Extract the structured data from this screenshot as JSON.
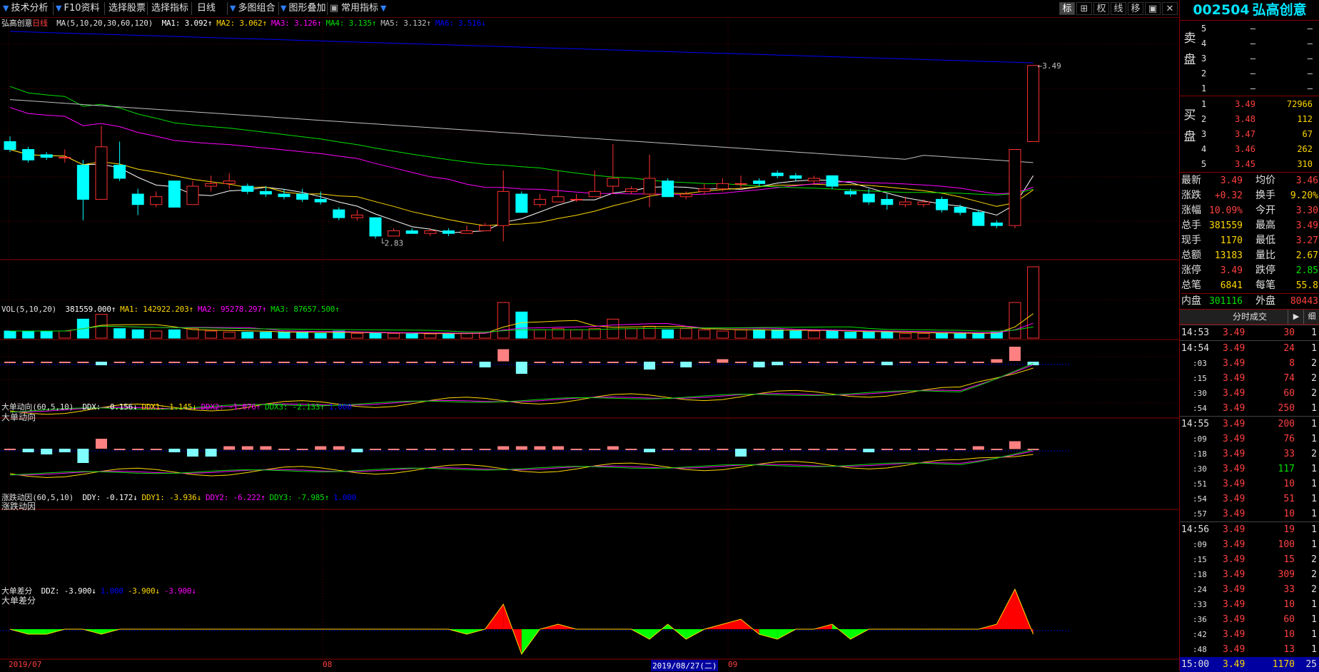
{
  "toolbar": {
    "items": [
      "技术分析",
      "F10资料",
      "选择股票",
      "选择指标",
      "日线",
      "多图组合",
      "图形叠加",
      "常用指标"
    ],
    "right_icons": [
      "标",
      "⊞",
      "权",
      "线",
      "移",
      "▣",
      "✕"
    ]
  },
  "main_chart": {
    "stock_label": "弘高创意",
    "period_label": "日线",
    "indicator_label": "MA(5,10,20,30,60,120)",
    "ma_values": [
      {
        "text": "MA1: 3.092↑",
        "color": "#ffffff"
      },
      {
        "text": "MA2: 3.062↑",
        "color": "#ffd700"
      },
      {
        "text": "MA3: 3.126↑",
        "color": "#ff00ff"
      },
      {
        "text": "MA4: 3.135↑",
        "color": "#00e000"
      },
      {
        "text": "MA5: 3.132↑",
        "color": "#c0c0c0"
      },
      {
        "text": "MA6: 3.516↓",
        "color": "#0000ff"
      }
    ],
    "high_label": "3.49",
    "low_label": "2.83"
  },
  "volume_panel": {
    "title": "VOL(5,10,20)",
    "values": [
      {
        "text": "381559.000↑",
        "color": "#ffffff"
      },
      {
        "text": "MA1: 142922.203↑",
        "color": "#ffd700"
      },
      {
        "text": "MA2: 95278.297↑",
        "color": "#ff00ff"
      },
      {
        "text": "MA3: 87657.500↑",
        "color": "#00e000"
      }
    ]
  },
  "ddx_panel": {
    "header": "大单动向(60,5,10)",
    "title": "大单动向",
    "values": [
      {
        "text": "DDX: -0.156↓",
        "color": "#ffffff"
      },
      {
        "text": "DDX1: 1.145↓",
        "color": "#ffd700"
      },
      {
        "text": "DDX2: -1.076↑",
        "color": "#ff00ff"
      },
      {
        "text": "DDX3: -2.133↑",
        "color": "#00e000"
      },
      {
        "text": "1.000",
        "color": "#0000ff"
      }
    ]
  },
  "ddy_panel": {
    "header": "涨跌动因(60,5,10)",
    "title": "涨跌动因",
    "values": [
      {
        "text": "DDY: -0.172↓",
        "color": "#ffffff"
      },
      {
        "text": "DDY1: -3.936↓",
        "color": "#ffd700"
      },
      {
        "text": "DDY2: -6.222↑",
        "color": "#ff00ff"
      },
      {
        "text": "DDY3: -7.985↑",
        "color": "#00e000"
      },
      {
        "text": "1.000",
        "color": "#0000ff"
      }
    ]
  },
  "ddz_panel": {
    "header": "大单差分",
    "title": "大单差分",
    "values": [
      {
        "text": "DDZ: -3.900↓",
        "color": "#ffffff"
      },
      {
        "text": "1.000",
        "color": "#0000ff"
      },
      {
        "text": "-3.900↓",
        "color": "#ffd700"
      },
      {
        "text": "-3.900↓",
        "color": "#ff00ff"
      }
    ]
  },
  "date_axis": {
    "labels": [
      "2019/07",
      "08",
      "2019/08/27(二)",
      "09"
    ]
  },
  "quote_panel": {
    "code": "002504",
    "name": "弘高创意",
    "sell_label": "卖盘",
    "buy_label": "买盘",
    "sell_book": [
      {
        "level": "5",
        "price": "–",
        "vol": "–"
      },
      {
        "level": "4",
        "price": "–",
        "vol": "–"
      },
      {
        "level": "3",
        "price": "–",
        "vol": "–"
      },
      {
        "level": "2",
        "price": "–",
        "vol": "–"
      },
      {
        "level": "1",
        "price": "–",
        "vol": "–"
      }
    ],
    "buy_book": [
      {
        "level": "1",
        "price": "3.49",
        "vol": "72966"
      },
      {
        "level": "2",
        "price": "3.48",
        "vol": "112"
      },
      {
        "level": "3",
        "price": "3.47",
        "vol": "67"
      },
      {
        "level": "4",
        "price": "3.46",
        "vol": "262"
      },
      {
        "level": "5",
        "price": "3.45",
        "vol": "310"
      }
    ],
    "stats": [
      {
        "k1": "最新",
        "v1": "3.49",
        "c1": "red",
        "k2": "均价",
        "v2": "3.46",
        "c2": "red"
      },
      {
        "k1": "涨跌",
        "v1": "+0.32",
        "c1": "red",
        "k2": "换手",
        "v2": "9.20%",
        "c2": "yellow"
      },
      {
        "k1": "涨幅",
        "v1": "10.09%",
        "c1": "red",
        "k2": "今开",
        "v2": "3.30",
        "c2": "red"
      },
      {
        "k1": "总手",
        "v1": "381559",
        "c1": "yellow",
        "k2": "最高",
        "v2": "3.49",
        "c2": "red"
      },
      {
        "k1": "现手",
        "v1": "1170",
        "c1": "yellow",
        "k2": "最低",
        "v2": "3.27",
        "c2": "red"
      },
      {
        "k1": "总额",
        "v1": "13183",
        "c1": "yellow",
        "k2": "量比",
        "v2": "2.67",
        "c2": "yellow"
      },
      {
        "k1": "涨停",
        "v1": "3.49",
        "c1": "red",
        "k2": "跌停",
        "v2": "2.85",
        "c2": "green"
      },
      {
        "k1": "总笔",
        "v1": "6841",
        "c1": "yellow",
        "k2": "每笔",
        "v2": "55.8",
        "c2": "yellow"
      },
      {
        "k1": "内盘",
        "v1": "301116",
        "c1": "green",
        "k2": "外盘",
        "v2": "80443",
        "c2": "red"
      }
    ],
    "trades_title": "分时成交",
    "trades_btn1": "▶",
    "trades_btn2": "细",
    "trades": [
      {
        "t": "14:53",
        "p": "3.49",
        "v": "30",
        "vc": "red",
        "n": "1",
        "m": true
      },
      {
        "t": "14:54",
        "p": "3.49",
        "v": "24",
        "vc": "red",
        "n": "1",
        "m": true
      },
      {
        "t": ":03",
        "p": "3.49",
        "v": "8",
        "vc": "red",
        "n": "2",
        "m": false
      },
      {
        "t": ":15",
        "p": "3.49",
        "v": "74",
        "vc": "red",
        "n": "2",
        "m": false
      },
      {
        "t": ":30",
        "p": "3.49",
        "v": "60",
        "vc": "red",
        "n": "2",
        "m": false
      },
      {
        "t": ":54",
        "p": "3.49",
        "v": "250",
        "vc": "red",
        "n": "1",
        "m": false
      },
      {
        "t": "14:55",
        "p": "3.49",
        "v": "200",
        "vc": "red",
        "n": "1",
        "m": true
      },
      {
        "t": ":09",
        "p": "3.49",
        "v": "76",
        "vc": "red",
        "n": "1",
        "m": false
      },
      {
        "t": ":18",
        "p": "3.49",
        "v": "33",
        "vc": "red",
        "n": "2",
        "m": false
      },
      {
        "t": ":30",
        "p": "3.49",
        "v": "117",
        "vc": "green",
        "n": "1",
        "m": false
      },
      {
        "t": ":51",
        "p": "3.49",
        "v": "10",
        "vc": "red",
        "n": "1",
        "m": false
      },
      {
        "t": ":54",
        "p": "3.49",
        "v": "51",
        "vc": "red",
        "n": "1",
        "m": false
      },
      {
        "t": ":57",
        "p": "3.49",
        "v": "10",
        "vc": "red",
        "n": "1",
        "m": false
      },
      {
        "t": "14:56",
        "p": "3.49",
        "v": "19",
        "vc": "red",
        "n": "1",
        "m": true
      },
      {
        "t": ":09",
        "p": "3.49",
        "v": "100",
        "vc": "red",
        "n": "1",
        "m": false
      },
      {
        "t": ":15",
        "p": "3.49",
        "v": "15",
        "vc": "red",
        "n": "2",
        "m": false
      },
      {
        "t": ":18",
        "p": "3.49",
        "v": "309",
        "vc": "red",
        "n": "2",
        "m": false
      },
      {
        "t": ":24",
        "p": "3.49",
        "v": "33",
        "vc": "red",
        "n": "2",
        "m": false
      },
      {
        "t": ":33",
        "p": "3.49",
        "v": "10",
        "vc": "red",
        "n": "1",
        "m": false
      },
      {
        "t": ":36",
        "p": "3.49",
        "v": "60",
        "vc": "red",
        "n": "1",
        "m": false
      },
      {
        "t": ":42",
        "p": "3.49",
        "v": "10",
        "vc": "red",
        "n": "1",
        "m": false
      },
      {
        "t": ":48",
        "p": "3.49",
        "v": "13",
        "vc": "red",
        "n": "1",
        "m": false
      },
      {
        "t": "15:00",
        "p": "3.49",
        "v": "1170",
        "vc": "yellow",
        "n": "25",
        "m": true,
        "final": true
      }
    ]
  },
  "chart_data": {
    "type": "candlestick",
    "price_range": [
      2.75,
      3.62
    ],
    "candles": [
      [
        3.2,
        3.17,
        3.22,
        3.16
      ],
      [
        3.17,
        3.13,
        3.18,
        3.12
      ],
      [
        3.15,
        3.14,
        3.16,
        3.13
      ],
      [
        3.14,
        3.14,
        3.17,
        3.12
      ],
      [
        3.11,
        2.98,
        3.13,
        2.9
      ],
      [
        2.98,
        3.18,
        3.26,
        2.98
      ],
      [
        3.11,
        3.06,
        3.2,
        3.05
      ],
      [
        3.0,
        2.96,
        3.02,
        2.92
      ],
      [
        2.96,
        2.99,
        3.01,
        2.95
      ],
      [
        3.05,
        2.95,
        3.05,
        2.95
      ],
      [
        2.96,
        3.03,
        3.05,
        2.96
      ],
      [
        3.03,
        3.04,
        3.07,
        3.01
      ],
      [
        3.04,
        3.05,
        3.08,
        3.02
      ],
      [
        3.03,
        3.01,
        3.04,
        3.0
      ],
      [
        3.01,
        3.0,
        3.03,
        2.99
      ],
      [
        3.0,
        2.99,
        3.02,
        2.98
      ],
      [
        3.0,
        2.98,
        3.02,
        2.97
      ],
      [
        2.98,
        2.97,
        3.01,
        2.96
      ],
      [
        2.94,
        2.91,
        2.95,
        2.9
      ],
      [
        2.91,
        2.92,
        2.94,
        2.9
      ],
      [
        2.91,
        2.84,
        2.91,
        2.83
      ],
      [
        2.84,
        2.86,
        2.87,
        2.84
      ],
      [
        2.86,
        2.85,
        2.87,
        2.85
      ],
      [
        2.85,
        2.86,
        2.87,
        2.84
      ],
      [
        2.86,
        2.85,
        2.87,
        2.84
      ],
      [
        2.85,
        2.86,
        2.88,
        2.85
      ],
      [
        2.86,
        2.88,
        2.89,
        2.86
      ],
      [
        2.88,
        3.01,
        3.09,
        2.82
      ],
      [
        3.0,
        2.93,
        3.01,
        2.93
      ],
      [
        2.96,
        2.98,
        3.0,
        2.95
      ],
      [
        2.97,
        2.99,
        3.09,
        2.97
      ],
      [
        2.98,
        2.98,
        3.0,
        2.97
      ],
      [
        2.99,
        3.01,
        3.09,
        2.99
      ],
      [
        3.03,
        3.06,
        3.19,
        3.0
      ],
      [
        3.01,
        3.02,
        3.03,
        3.0
      ],
      [
        3.0,
        3.06,
        3.15,
        2.95
      ],
      [
        3.05,
        2.99,
        3.06,
        2.99
      ],
      [
        2.99,
        3.0,
        3.01,
        2.98
      ],
      [
        3.01,
        3.02,
        3.04,
        3.0
      ],
      [
        3.02,
        3.04,
        3.06,
        3.01
      ],
      [
        3.04,
        3.04,
        3.07,
        3.02
      ],
      [
        3.05,
        3.04,
        3.06,
        3.03
      ],
      [
        3.08,
        3.07,
        3.09,
        3.06
      ],
      [
        3.07,
        3.06,
        3.08,
        3.05
      ],
      [
        3.05,
        3.06,
        3.07,
        3.04
      ],
      [
        3.07,
        3.03,
        3.07,
        3.02
      ],
      [
        3.01,
        3.0,
        3.02,
        2.99
      ],
      [
        3.0,
        2.97,
        3.02,
        2.96
      ],
      [
        2.98,
        2.96,
        3.0,
        2.94
      ],
      [
        2.96,
        2.97,
        2.99,
        2.95
      ],
      [
        2.96,
        2.97,
        2.98,
        2.95
      ],
      [
        2.98,
        2.94,
        2.99,
        2.93
      ],
      [
        2.95,
        2.93,
        2.96,
        2.92
      ],
      [
        2.93,
        2.88,
        2.94,
        2.88
      ],
      [
        2.89,
        2.88,
        2.9,
        2.87
      ],
      [
        2.88,
        3.17,
        3.17,
        2.87
      ],
      [
        3.2,
        3.49,
        3.49,
        3.27
      ]
    ],
    "volume": [
      30,
      30,
      30,
      30,
      80,
      100,
      40,
      35,
      30,
      35,
      40,
      30,
      25,
      25,
      25,
      25,
      25,
      20,
      30,
      20,
      20,
      20,
      18,
      18,
      20,
      20,
      25,
      150,
      110,
      35,
      40,
      35,
      40,
      80,
      40,
      50,
      35,
      40,
      35,
      30,
      35,
      35,
      35,
      30,
      30,
      30,
      25,
      25,
      25,
      20,
      20,
      20,
      20,
      20,
      25,
      150,
      300
    ],
    "ma_lines": [
      "MA1",
      "MA2",
      "MA3",
      "MA4",
      "MA5",
      "MA6"
    ],
    "ddx": {
      "lines": [
        "DDX1",
        "DDX2",
        "DDX3"
      ],
      "bars": [
        0,
        0,
        0,
        0,
        0,
        -1,
        0,
        0,
        0,
        0,
        0,
        0,
        0,
        0,
        0,
        0,
        0,
        0,
        0,
        0,
        0,
        0,
        0,
        0,
        0,
        0,
        -2,
        5,
        -5,
        0,
        0,
        0,
        0,
        0,
        0,
        -3,
        0,
        -2,
        0,
        1,
        0,
        -2,
        -1,
        0,
        0,
        0,
        0,
        0,
        -1,
        0,
        0,
        0,
        0,
        0,
        1,
        6,
        -1
      ]
    },
    "ddy": {
      "lines": [
        "DDY1",
        "DDY2",
        "DDY3"
      ],
      "bars": [
        0,
        -1,
        -2,
        -1,
        -6,
        4,
        0,
        0,
        0,
        -1,
        -3,
        -3,
        1,
        1,
        1,
        0,
        0,
        1,
        1,
        -1,
        0,
        0,
        0,
        0,
        0,
        0,
        0,
        1,
        1,
        1,
        1,
        0,
        0,
        1,
        0,
        -1,
        0,
        0,
        0,
        0,
        -3,
        0,
        0,
        0,
        0,
        0,
        0,
        -1,
        0,
        0,
        0,
        0,
        0,
        1,
        0,
        3,
        0
      ]
    },
    "ddz": [
      0,
      -1,
      -1,
      0,
      0,
      -1,
      0,
      0,
      0,
      0,
      0,
      0,
      0,
      0,
      0,
      0,
      0,
      0,
      0,
      0,
      0,
      0,
      0,
      0,
      0,
      -1,
      0,
      5,
      -5,
      0,
      1,
      0,
      0,
      0,
      0,
      -2,
      1,
      -2,
      0,
      1,
      2,
      -1,
      -2,
      0,
      0,
      1,
      -2,
      0,
      0,
      0,
      0,
      0,
      0,
      0,
      1,
      8,
      -1
    ]
  }
}
